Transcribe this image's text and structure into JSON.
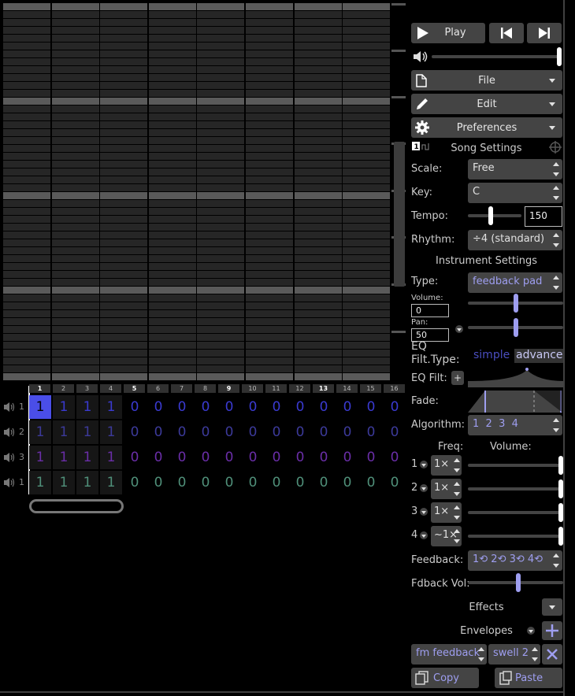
{
  "colors": {
    "note_ch1": "#3a3ad0",
    "note_ch2": "#3c3a9a",
    "note_ch3": "#6a2ea8",
    "note_ch4": "#50907a",
    "accent": "#9e9ef0",
    "selected_cell": "#4a4ee8"
  },
  "pattern": {
    "bar_numbers": [
      "1",
      "2",
      "3",
      "4",
      "5",
      "6",
      "7",
      "8",
      "9",
      "10",
      "11",
      "12",
      "13",
      "14",
      "15",
      "16"
    ],
    "highlighted_bars": [
      0,
      4,
      8,
      12
    ],
    "channels": [
      {
        "label": "1",
        "values": [
          "1",
          "1",
          "1",
          "1",
          "0",
          "0",
          "0",
          "0",
          "0",
          "0",
          "0",
          "0",
          "0",
          "0",
          "0",
          "0"
        ]
      },
      {
        "label": "2",
        "values": [
          "1",
          "1",
          "1",
          "1",
          "0",
          "0",
          "0",
          "0",
          "0",
          "0",
          "0",
          "0",
          "0",
          "0",
          "0",
          "0"
        ]
      },
      {
        "label": "3",
        "values": [
          "1",
          "1",
          "1",
          "1",
          "0",
          "0",
          "0",
          "0",
          "0",
          "0",
          "0",
          "0",
          "0",
          "0",
          "0",
          "0"
        ]
      },
      {
        "label": "1",
        "values": [
          "1",
          "1",
          "1",
          "1",
          "0",
          "0",
          "0",
          "0",
          "0",
          "0",
          "0",
          "0",
          "0",
          "0",
          "0",
          "0"
        ]
      }
    ]
  },
  "transport": {
    "play_label": "Play",
    "icons": [
      "play-icon",
      "skip-back-icon",
      "skip-forward-icon",
      "volume-icon"
    ],
    "volume": 1.0
  },
  "menus": {
    "file": "File",
    "edit": "Edit",
    "preferences": "Preferences"
  },
  "song": {
    "heading": "Song Settings",
    "scale_label": "Scale:",
    "scale_value": "Free",
    "key_label": "Key:",
    "key_value": "C",
    "tempo_label": "Tempo:",
    "tempo_value": "150",
    "rhythm_label": "Rhythm:",
    "rhythm_value": "÷4 (standard)"
  },
  "instrument": {
    "heading": "Instrument Settings",
    "type_label": "Type:",
    "type_value": "feedback pad",
    "volume_label": "Volume:",
    "volume_value": "0",
    "pan_label": "Pan:",
    "pan_value": "50",
    "eq_label": "EQ Filt.Type:",
    "eq_simple": "simple",
    "eq_advanced": "advanced",
    "eq_filt_label": "EQ Filt:",
    "eq_add": "+",
    "fade_label": "Fade:",
    "algorithm_label": "Algorithm:",
    "algorithm_value": "1  2  3  4",
    "freq_label": "Freq:",
    "osc_volume_label": "Volume:",
    "operators": [
      {
        "num": "1",
        "freq": "1×"
      },
      {
        "num": "2",
        "freq": "1×"
      },
      {
        "num": "3",
        "freq": "1×"
      },
      {
        "num": "4",
        "freq": "~1×"
      }
    ],
    "feedback_label": "Feedback:",
    "feedback_value": "1⟲ 2⟲ 3⟲ 4⟲",
    "fdback_vol_label": "Fdback Vol:",
    "effects_label": "Effects",
    "envelopes_label": "Envelopes",
    "envelope_target": "fm feedback",
    "envelope_shape": "swell 2"
  },
  "clipboard": {
    "copy": "Copy",
    "paste": "Paste"
  }
}
